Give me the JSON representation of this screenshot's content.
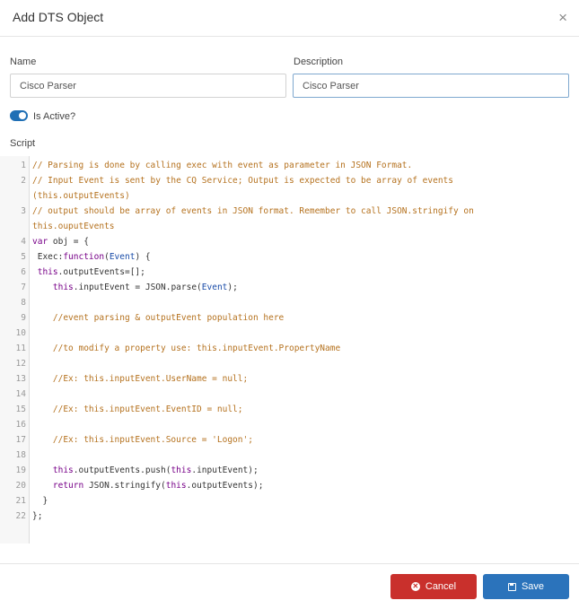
{
  "dialog": {
    "title": "Add DTS Object",
    "close_glyph": "×"
  },
  "form": {
    "name_label": "Name",
    "name_value": "Cisco Parser",
    "description_label": "Description",
    "description_value": "Cisco Parser",
    "active_label": "Is Active?",
    "active_on": true,
    "script_label": "Script"
  },
  "editor": {
    "line_numbers": [
      "1",
      "2",
      "",
      "3",
      "",
      "4",
      "5",
      "6",
      "7",
      "8",
      "9",
      "10",
      "11",
      "12",
      "13",
      "14",
      "15",
      "16",
      "17",
      "18",
      "19",
      "20",
      "21",
      "22"
    ],
    "lines": [
      "// Parsing is done by calling exec with event as parameter in JSON Format.",
      "// Input Event is sent by the CQ Service; Output is expected to be array of events",
      "(this.outputEvents)",
      "// output should be array of events in JSON format. Remember to call JSON.stringify on",
      "this.ouputEvents",
      "var obj = {",
      " Exec:function(Event) {",
      " this.outputEvents=[];",
      "    this.inputEvent = JSON.parse(Event);",
      "",
      "    //event parsing & outputEvent population here",
      "",
      "    //to modify a property use: this.inputEvent.PropertyName",
      "",
      "    //Ex: this.inputEvent.UserName = null;",
      "",
      "    //Ex: this.inputEvent.EventID = null;",
      "",
      "    //Ex: this.inputEvent.Source = 'Logon';",
      "",
      "    this.outputEvents.push(this.inputEvent);",
      "    return JSON.stringify(this.outputEvents);",
      "  }",
      "};"
    ]
  },
  "footer": {
    "cancel_label": "Cancel",
    "save_label": "Save"
  },
  "colors": {
    "cancel": "#c9302c",
    "save": "#2b73bb",
    "comment": "#b5721f",
    "keyword": "#770088",
    "variable": "#1a4ca8",
    "toggle": "#1f6fb5"
  },
  "icons": {
    "cancel": "times-circle-icon",
    "save": "floppy-disk-icon",
    "close": "close-icon"
  }
}
